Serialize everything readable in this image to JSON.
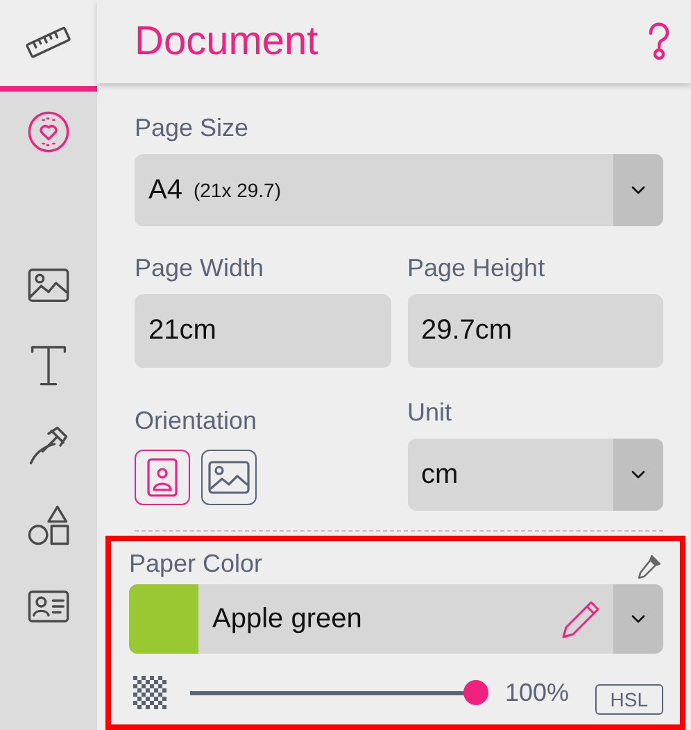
{
  "sidebar": {
    "tabs": [
      {
        "kind": "ruler",
        "selected": true,
        "highlighted": false
      },
      {
        "kind": "heart",
        "selected": false,
        "highlighted": true
      },
      {
        "kind": "image",
        "selected": false,
        "highlighted": false
      },
      {
        "kind": "text",
        "selected": false,
        "highlighted": false
      },
      {
        "kind": "tool",
        "selected": false,
        "highlighted": false
      },
      {
        "kind": "shapes",
        "selected": false,
        "highlighted": false
      },
      {
        "kind": "card",
        "selected": false,
        "highlighted": false
      }
    ]
  },
  "header": {
    "title": "Document"
  },
  "page_size": {
    "label": "Page Size",
    "value": "A4",
    "detail": "(21x 29.7)"
  },
  "page_width": {
    "label": "Page Width",
    "value": "21cm"
  },
  "page_height": {
    "label": "Page Height",
    "value": "29.7cm"
  },
  "orientation": {
    "label": "Orientation",
    "options": [
      {
        "kind": "portrait",
        "selected": true
      },
      {
        "kind": "landscape",
        "selected": false
      }
    ]
  },
  "unit": {
    "label": "Unit",
    "value": "cm"
  },
  "paper_color": {
    "label": "Paper Color",
    "name": "Apple green",
    "color": "#9ac833",
    "opacity": {
      "level": 1.0,
      "reading": "100%"
    },
    "mode": "HSL"
  }
}
